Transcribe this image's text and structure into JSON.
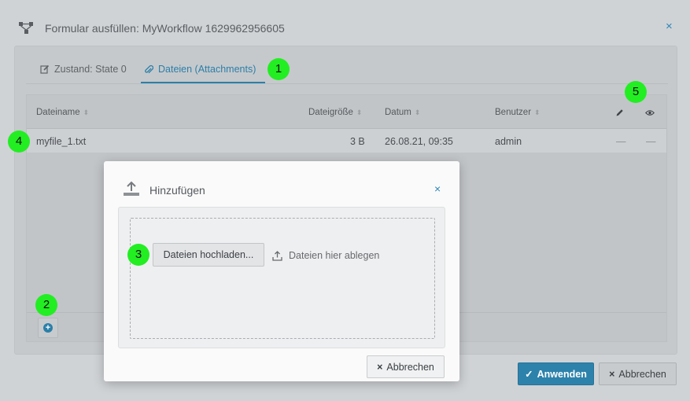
{
  "outer": {
    "title": "Formular ausfüllen: MyWorkflow 1629962956605",
    "close_label": "×",
    "tabs": [
      {
        "label": "Zustand: State 0",
        "icon": "edit-icon"
      },
      {
        "label": "Dateien (Attachments)",
        "icon": "paperclip-icon"
      }
    ],
    "apply_label": "Anwenden",
    "cancel_label": "Abbrechen"
  },
  "grid": {
    "columns": [
      "Dateiname",
      "Dateigröße",
      "Datum",
      "Benutzer"
    ],
    "rows": [
      {
        "name": "myfile_1.txt",
        "size": "3 B",
        "date": "26.08.21, 09:35",
        "user": "admin",
        "edit": "—",
        "view": "—"
      }
    ]
  },
  "modal": {
    "title": "Hinzufügen",
    "close_label": "×",
    "upload_label": "Dateien hochladen...",
    "drop_hint": "Dateien hier ablegen",
    "cancel_label": "Abbrechen"
  },
  "markers": [
    "1",
    "2",
    "3",
    "4",
    "5"
  ],
  "colors": {
    "accent": "#2d82ab",
    "marker": "#22ee22"
  }
}
